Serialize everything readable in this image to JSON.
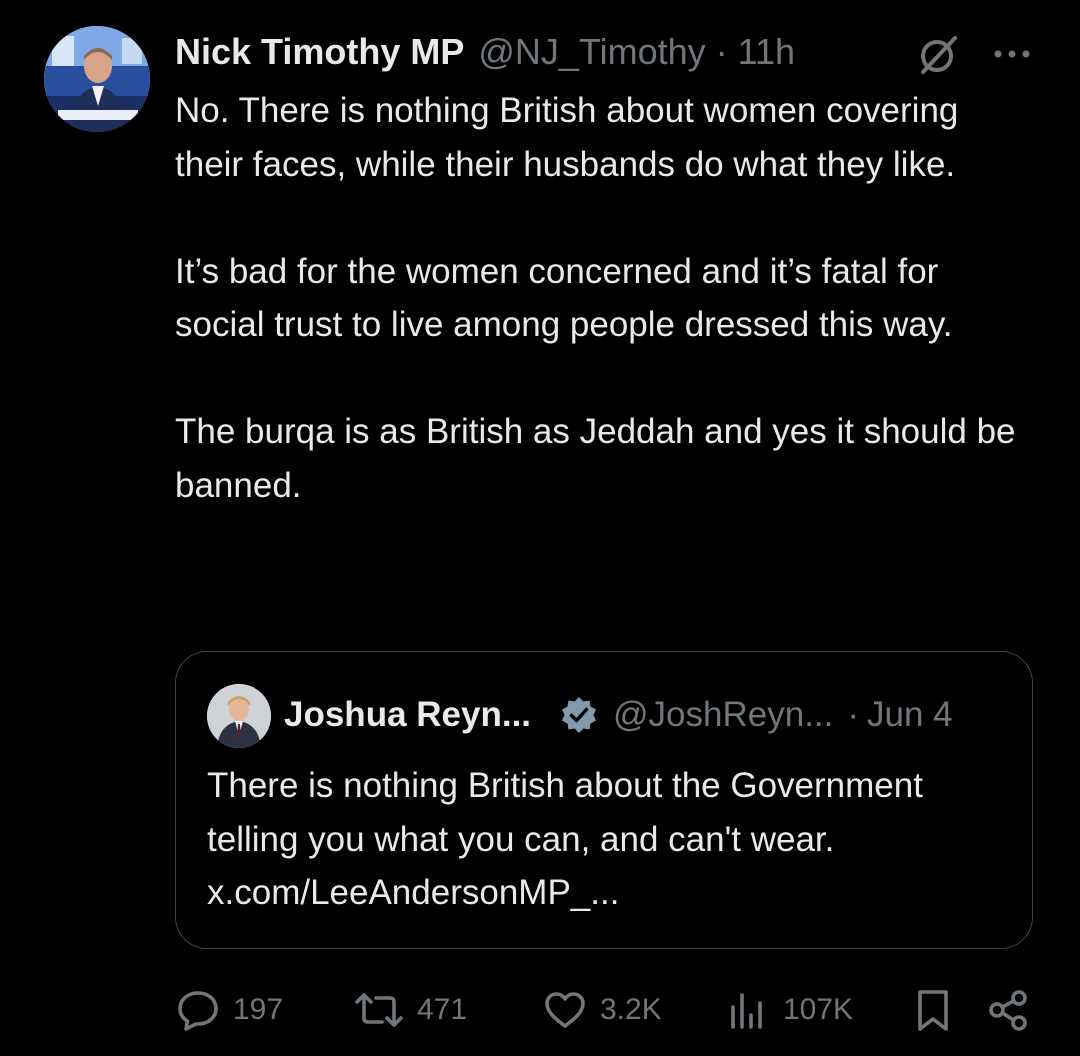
{
  "tweet": {
    "author_name": "Nick Timothy MP",
    "author_handle": "@NJ_Timothy",
    "separator": "·",
    "time": "11h",
    "paragraphs": [
      "No. There is nothing British about women covering their faces, while their husbands do what they like.",
      "It’s bad for the women concerned and it’s fatal for social trust to live among people dressed this way.",
      "The burqa is as British as Jeddah and yes it should be banned."
    ]
  },
  "quote": {
    "author_name": "Joshua Reyn...",
    "author_handle": "@JoshReyn...",
    "separator": "·",
    "date": "Jun 4",
    "text": "There is nothing British about the Government telling you what you can, and can't wear. x.com/LeeAndersonMP_..."
  },
  "actions": {
    "replies": "197",
    "reposts": "471",
    "likes": "3.2K",
    "views": "107K"
  },
  "icons": {
    "grok": "grok-icon",
    "more": "more-options-icon",
    "verified": "verified-badge-icon",
    "reply": "reply-icon",
    "repost": "repost-icon",
    "like": "heart-icon",
    "views": "views-icon",
    "bookmark": "bookmark-icon",
    "share": "share-icon"
  },
  "colors": {
    "background": "#000000",
    "text_primary": "#e7e9ea",
    "text_secondary": "#71767b",
    "border": "#3e4144",
    "verified_badge": "#829aab"
  }
}
